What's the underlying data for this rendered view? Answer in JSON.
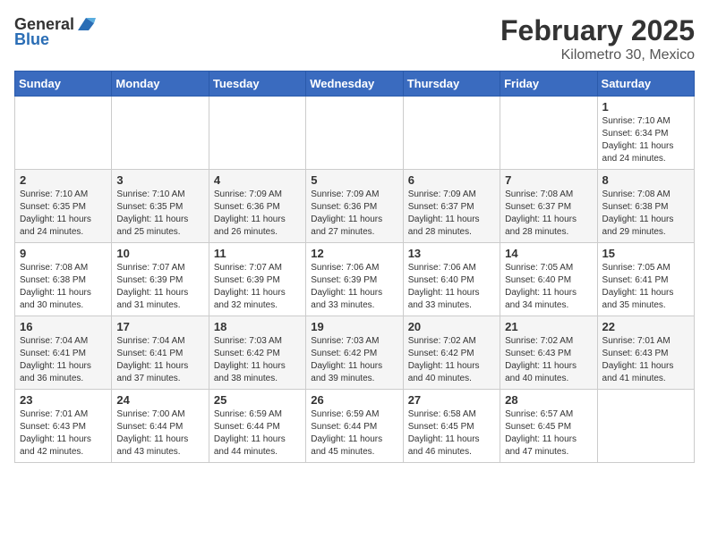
{
  "header": {
    "logo_general": "General",
    "logo_blue": "Blue",
    "month_title": "February 2025",
    "location": "Kilometro 30, Mexico"
  },
  "days_of_week": [
    "Sunday",
    "Monday",
    "Tuesday",
    "Wednesday",
    "Thursday",
    "Friday",
    "Saturday"
  ],
  "weeks": [
    [
      {
        "day": "",
        "info": ""
      },
      {
        "day": "",
        "info": ""
      },
      {
        "day": "",
        "info": ""
      },
      {
        "day": "",
        "info": ""
      },
      {
        "day": "",
        "info": ""
      },
      {
        "day": "",
        "info": ""
      },
      {
        "day": "1",
        "info": "Sunrise: 7:10 AM\nSunset: 6:34 PM\nDaylight: 11 hours\nand 24 minutes."
      }
    ],
    [
      {
        "day": "2",
        "info": "Sunrise: 7:10 AM\nSunset: 6:35 PM\nDaylight: 11 hours\nand 24 minutes."
      },
      {
        "day": "3",
        "info": "Sunrise: 7:10 AM\nSunset: 6:35 PM\nDaylight: 11 hours\nand 25 minutes."
      },
      {
        "day": "4",
        "info": "Sunrise: 7:09 AM\nSunset: 6:36 PM\nDaylight: 11 hours\nand 26 minutes."
      },
      {
        "day": "5",
        "info": "Sunrise: 7:09 AM\nSunset: 6:36 PM\nDaylight: 11 hours\nand 27 minutes."
      },
      {
        "day": "6",
        "info": "Sunrise: 7:09 AM\nSunset: 6:37 PM\nDaylight: 11 hours\nand 28 minutes."
      },
      {
        "day": "7",
        "info": "Sunrise: 7:08 AM\nSunset: 6:37 PM\nDaylight: 11 hours\nand 28 minutes."
      },
      {
        "day": "8",
        "info": "Sunrise: 7:08 AM\nSunset: 6:38 PM\nDaylight: 11 hours\nand 29 minutes."
      }
    ],
    [
      {
        "day": "9",
        "info": "Sunrise: 7:08 AM\nSunset: 6:38 PM\nDaylight: 11 hours\nand 30 minutes."
      },
      {
        "day": "10",
        "info": "Sunrise: 7:07 AM\nSunset: 6:39 PM\nDaylight: 11 hours\nand 31 minutes."
      },
      {
        "day": "11",
        "info": "Sunrise: 7:07 AM\nSunset: 6:39 PM\nDaylight: 11 hours\nand 32 minutes."
      },
      {
        "day": "12",
        "info": "Sunrise: 7:06 AM\nSunset: 6:39 PM\nDaylight: 11 hours\nand 33 minutes."
      },
      {
        "day": "13",
        "info": "Sunrise: 7:06 AM\nSunset: 6:40 PM\nDaylight: 11 hours\nand 33 minutes."
      },
      {
        "day": "14",
        "info": "Sunrise: 7:05 AM\nSunset: 6:40 PM\nDaylight: 11 hours\nand 34 minutes."
      },
      {
        "day": "15",
        "info": "Sunrise: 7:05 AM\nSunset: 6:41 PM\nDaylight: 11 hours\nand 35 minutes."
      }
    ],
    [
      {
        "day": "16",
        "info": "Sunrise: 7:04 AM\nSunset: 6:41 PM\nDaylight: 11 hours\nand 36 minutes."
      },
      {
        "day": "17",
        "info": "Sunrise: 7:04 AM\nSunset: 6:41 PM\nDaylight: 11 hours\nand 37 minutes."
      },
      {
        "day": "18",
        "info": "Sunrise: 7:03 AM\nSunset: 6:42 PM\nDaylight: 11 hours\nand 38 minutes."
      },
      {
        "day": "19",
        "info": "Sunrise: 7:03 AM\nSunset: 6:42 PM\nDaylight: 11 hours\nand 39 minutes."
      },
      {
        "day": "20",
        "info": "Sunrise: 7:02 AM\nSunset: 6:42 PM\nDaylight: 11 hours\nand 40 minutes."
      },
      {
        "day": "21",
        "info": "Sunrise: 7:02 AM\nSunset: 6:43 PM\nDaylight: 11 hours\nand 40 minutes."
      },
      {
        "day": "22",
        "info": "Sunrise: 7:01 AM\nSunset: 6:43 PM\nDaylight: 11 hours\nand 41 minutes."
      }
    ],
    [
      {
        "day": "23",
        "info": "Sunrise: 7:01 AM\nSunset: 6:43 PM\nDaylight: 11 hours\nand 42 minutes."
      },
      {
        "day": "24",
        "info": "Sunrise: 7:00 AM\nSunset: 6:44 PM\nDaylight: 11 hours\nand 43 minutes."
      },
      {
        "day": "25",
        "info": "Sunrise: 6:59 AM\nSunset: 6:44 PM\nDaylight: 11 hours\nand 44 minutes."
      },
      {
        "day": "26",
        "info": "Sunrise: 6:59 AM\nSunset: 6:44 PM\nDaylight: 11 hours\nand 45 minutes."
      },
      {
        "day": "27",
        "info": "Sunrise: 6:58 AM\nSunset: 6:45 PM\nDaylight: 11 hours\nand 46 minutes."
      },
      {
        "day": "28",
        "info": "Sunrise: 6:57 AM\nSunset: 6:45 PM\nDaylight: 11 hours\nand 47 minutes."
      },
      {
        "day": "",
        "info": ""
      }
    ]
  ]
}
